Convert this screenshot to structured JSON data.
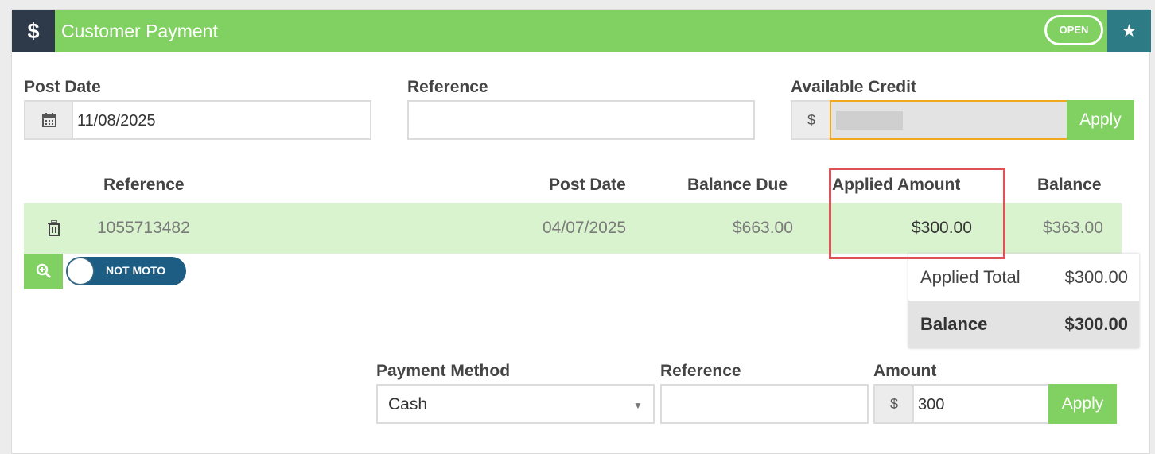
{
  "header": {
    "icon": "dollar-icon",
    "icon_glyph": "$",
    "title": "Customer Payment",
    "status": "OPEN",
    "favorite_icon": "star-icon",
    "favorite_glyph": "★",
    "accent_color": "#80d062",
    "dark_color": "#2e3a4a",
    "teal_color": "#2d7b85"
  },
  "form": {
    "post_date_label": "Post Date",
    "post_date_value": "11/08/2025",
    "calendar_icon": "calendar-icon",
    "reference_label": "Reference",
    "reference_value": "",
    "available_credit_label": "Available Credit",
    "currency_symbol": "$",
    "available_credit_value": "",
    "apply_label": "Apply"
  },
  "table": {
    "headers": [
      "Reference",
      "Post Date",
      "Balance Due",
      "Applied Amount",
      "Balance"
    ],
    "rows": [
      {
        "delete_icon": "trash-icon",
        "reference": "1055713482",
        "post_date": "04/07/2025",
        "balance_due": "$663.00",
        "applied_amount": "$300.00",
        "balance": "$363.00"
      }
    ],
    "row_color": "#d9f3cf"
  },
  "actions": {
    "zoom_icon": "zoom-in-icon",
    "moto_toggle_label": "NOT MOTO",
    "moto_toggle_on": false
  },
  "totals": {
    "applied_total_label": "Applied Total",
    "applied_total_value": "$300.00",
    "balance_label": "Balance",
    "balance_value": "$300.00"
  },
  "payment": {
    "method_label": "Payment Method",
    "method_value": "Cash",
    "reference_label": "Reference",
    "reference_value": "",
    "amount_label": "Amount",
    "currency_symbol": "$",
    "amount_value": "300",
    "apply_label": "Apply"
  }
}
